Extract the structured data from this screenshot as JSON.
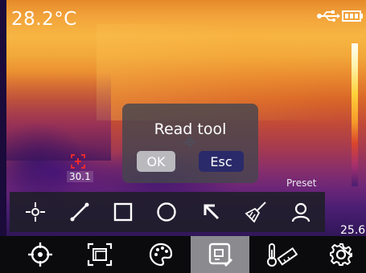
{
  "status_bar": {
    "temperature": "28.2°C",
    "usb_icon": "usb-icon",
    "battery_icon": "battery-icon"
  },
  "measurement": {
    "spot_value": "30.1",
    "scale_min": "25.6"
  },
  "dialog": {
    "title": "Read tool",
    "ok_label": "OK",
    "esc_label": "Esc"
  },
  "preset_label": "Preset",
  "tool_bar": {
    "items": [
      {
        "name": "point-tool",
        "icon": "point-crosshair-icon"
      },
      {
        "name": "line-tool",
        "icon": "line-icon"
      },
      {
        "name": "rectangle-tool",
        "icon": "square-icon"
      },
      {
        "name": "circle-tool",
        "icon": "circle-icon"
      },
      {
        "name": "arrow-tool",
        "icon": "arrow-icon"
      },
      {
        "name": "clear-tool",
        "icon": "broom-icon"
      },
      {
        "name": "person-tool",
        "icon": "person-icon"
      }
    ]
  },
  "main_bar": {
    "items": [
      {
        "name": "measure-target",
        "icon": "target-icon",
        "active": false
      },
      {
        "name": "image-mode",
        "icon": "picture-in-picture-icon",
        "active": false
      },
      {
        "name": "palette",
        "icon": "palette-icon",
        "active": false
      },
      {
        "name": "analysis-tools",
        "icon": "edit-box-icon",
        "active": true
      },
      {
        "name": "temperature-range",
        "icon": "thermometer-ruler-icon",
        "active": false
      },
      {
        "name": "settings",
        "icon": "gear-icon",
        "active": false
      }
    ]
  },
  "colors": {
    "dialog_bg": "#46464e",
    "ok_bg": "#b9b9be",
    "esc_bg": "#2a2a6a",
    "active_tab": "#8b8b8f"
  }
}
